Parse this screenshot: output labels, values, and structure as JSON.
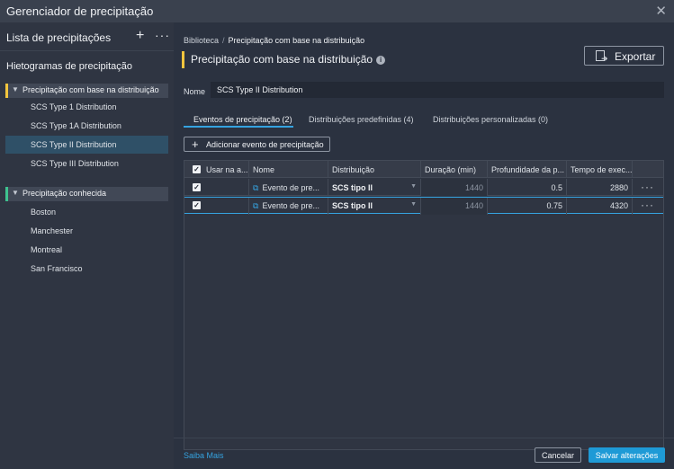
{
  "window": {
    "title": "Gerenciador de precipitação",
    "close_icon": "close-icon"
  },
  "sidebar": {
    "header": "Lista de precipitações",
    "add_symbol": "+",
    "more_symbol": "···",
    "section_title": "Hietogramas de precipitação",
    "groups": [
      {
        "label": "Precipitação com base na distribuição",
        "accent": "#f2c53d",
        "items": [
          "SCS Type 1 Distribution",
          "SCS Type 1A Distribution",
          "SCS Type II Distribution",
          "SCS Type III Distribution"
        ],
        "selected_index": 2
      },
      {
        "label": "Precipitação conhecida",
        "accent": "#3ec28f",
        "items": [
          "Boston",
          "Manchester",
          "Montreal",
          "San Francisco"
        ]
      }
    ]
  },
  "breadcrumb": {
    "root": "Biblioteca",
    "separator": "/",
    "current": "Precipitação com base na distribuição"
  },
  "page": {
    "title": "Precipitação com base na distribuição",
    "info_icon": "i"
  },
  "export": {
    "label": "Exportar"
  },
  "name": {
    "label": "Nome",
    "value": "SCS Type II Distribution"
  },
  "tabs": [
    {
      "label": "Eventos de precipitação (2)",
      "active": true
    },
    {
      "label": "Distribuições predefinidas (4)",
      "active": false
    },
    {
      "label": "Distribuições personalizadas (0)",
      "active": false
    }
  ],
  "add_event": {
    "symbol": "+",
    "label": "Adicionar evento de precipitação"
  },
  "table": {
    "columns": [
      "Usar na a...",
      "Nome",
      "Distribuição",
      "Duração (min)",
      "Profundidade da p...",
      "Tempo de exec..."
    ],
    "rows": [
      {
        "checked": true,
        "name": "Evento de pre...",
        "distribution": "SCS tipo II",
        "duration": "1440",
        "depth": "0.5",
        "time": "2880"
      },
      {
        "checked": true,
        "name": "Evento de pre...",
        "distribution": "SCS tipo II",
        "duration": "1440",
        "depth": "0.75",
        "time": "4320"
      }
    ],
    "check_mark": "✓",
    "more_symbol": "···",
    "link_symbol": "⧉",
    "dropdown_symbol": "▼"
  },
  "footer": {
    "learn_more": "Saiba Mais",
    "cancel": "Cancelar",
    "save": "Salvar alterações"
  },
  "colors": {
    "accent": "#35a3e0",
    "save_button": "#1e9ad6"
  }
}
